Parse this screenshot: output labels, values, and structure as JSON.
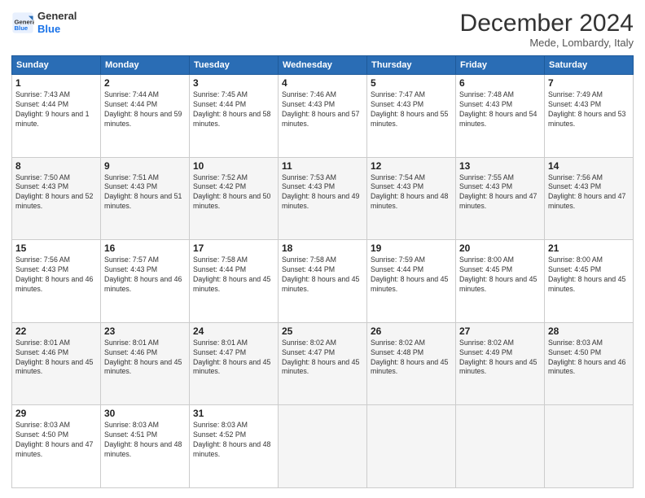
{
  "logo": {
    "line1": "General",
    "line2": "Blue"
  },
  "title": "December 2024",
  "subtitle": "Mede, Lombardy, Italy",
  "days_header": [
    "Sunday",
    "Monday",
    "Tuesday",
    "Wednesday",
    "Thursday",
    "Friday",
    "Saturday"
  ],
  "weeks": [
    [
      {
        "day": "1",
        "sunrise": "7:43 AM",
        "sunset": "4:44 PM",
        "daylight": "9 hours and 1 minute."
      },
      {
        "day": "2",
        "sunrise": "7:44 AM",
        "sunset": "4:44 PM",
        "daylight": "8 hours and 59 minutes."
      },
      {
        "day": "3",
        "sunrise": "7:45 AM",
        "sunset": "4:44 PM",
        "daylight": "8 hours and 58 minutes."
      },
      {
        "day": "4",
        "sunrise": "7:46 AM",
        "sunset": "4:43 PM",
        "daylight": "8 hours and 57 minutes."
      },
      {
        "day": "5",
        "sunrise": "7:47 AM",
        "sunset": "4:43 PM",
        "daylight": "8 hours and 55 minutes."
      },
      {
        "day": "6",
        "sunrise": "7:48 AM",
        "sunset": "4:43 PM",
        "daylight": "8 hours and 54 minutes."
      },
      {
        "day": "7",
        "sunrise": "7:49 AM",
        "sunset": "4:43 PM",
        "daylight": "8 hours and 53 minutes."
      }
    ],
    [
      {
        "day": "8",
        "sunrise": "7:50 AM",
        "sunset": "4:43 PM",
        "daylight": "8 hours and 52 minutes."
      },
      {
        "day": "9",
        "sunrise": "7:51 AM",
        "sunset": "4:43 PM",
        "daylight": "8 hours and 51 minutes."
      },
      {
        "day": "10",
        "sunrise": "7:52 AM",
        "sunset": "4:42 PM",
        "daylight": "8 hours and 50 minutes."
      },
      {
        "day": "11",
        "sunrise": "7:53 AM",
        "sunset": "4:43 PM",
        "daylight": "8 hours and 49 minutes."
      },
      {
        "day": "12",
        "sunrise": "7:54 AM",
        "sunset": "4:43 PM",
        "daylight": "8 hours and 48 minutes."
      },
      {
        "day": "13",
        "sunrise": "7:55 AM",
        "sunset": "4:43 PM",
        "daylight": "8 hours and 47 minutes."
      },
      {
        "day": "14",
        "sunrise": "7:56 AM",
        "sunset": "4:43 PM",
        "daylight": "8 hours and 47 minutes."
      }
    ],
    [
      {
        "day": "15",
        "sunrise": "7:56 AM",
        "sunset": "4:43 PM",
        "daylight": "8 hours and 46 minutes."
      },
      {
        "day": "16",
        "sunrise": "7:57 AM",
        "sunset": "4:43 PM",
        "daylight": "8 hours and 46 minutes."
      },
      {
        "day": "17",
        "sunrise": "7:58 AM",
        "sunset": "4:44 PM",
        "daylight": "8 hours and 45 minutes."
      },
      {
        "day": "18",
        "sunrise": "7:58 AM",
        "sunset": "4:44 PM",
        "daylight": "8 hours and 45 minutes."
      },
      {
        "day": "19",
        "sunrise": "7:59 AM",
        "sunset": "4:44 PM",
        "daylight": "8 hours and 45 minutes."
      },
      {
        "day": "20",
        "sunrise": "8:00 AM",
        "sunset": "4:45 PM",
        "daylight": "8 hours and 45 minutes."
      },
      {
        "day": "21",
        "sunrise": "8:00 AM",
        "sunset": "4:45 PM",
        "daylight": "8 hours and 45 minutes."
      }
    ],
    [
      {
        "day": "22",
        "sunrise": "8:01 AM",
        "sunset": "4:46 PM",
        "daylight": "8 hours and 45 minutes."
      },
      {
        "day": "23",
        "sunrise": "8:01 AM",
        "sunset": "4:46 PM",
        "daylight": "8 hours and 45 minutes."
      },
      {
        "day": "24",
        "sunrise": "8:01 AM",
        "sunset": "4:47 PM",
        "daylight": "8 hours and 45 minutes."
      },
      {
        "day": "25",
        "sunrise": "8:02 AM",
        "sunset": "4:47 PM",
        "daylight": "8 hours and 45 minutes."
      },
      {
        "day": "26",
        "sunrise": "8:02 AM",
        "sunset": "4:48 PM",
        "daylight": "8 hours and 45 minutes."
      },
      {
        "day": "27",
        "sunrise": "8:02 AM",
        "sunset": "4:49 PM",
        "daylight": "8 hours and 45 minutes."
      },
      {
        "day": "28",
        "sunrise": "8:03 AM",
        "sunset": "4:50 PM",
        "daylight": "8 hours and 46 minutes."
      }
    ],
    [
      {
        "day": "29",
        "sunrise": "8:03 AM",
        "sunset": "4:50 PM",
        "daylight": "8 hours and 47 minutes."
      },
      {
        "day": "30",
        "sunrise": "8:03 AM",
        "sunset": "4:51 PM",
        "daylight": "8 hours and 48 minutes."
      },
      {
        "day": "31",
        "sunrise": "8:03 AM",
        "sunset": "4:52 PM",
        "daylight": "8 hours and 48 minutes."
      },
      null,
      null,
      null,
      null
    ]
  ]
}
